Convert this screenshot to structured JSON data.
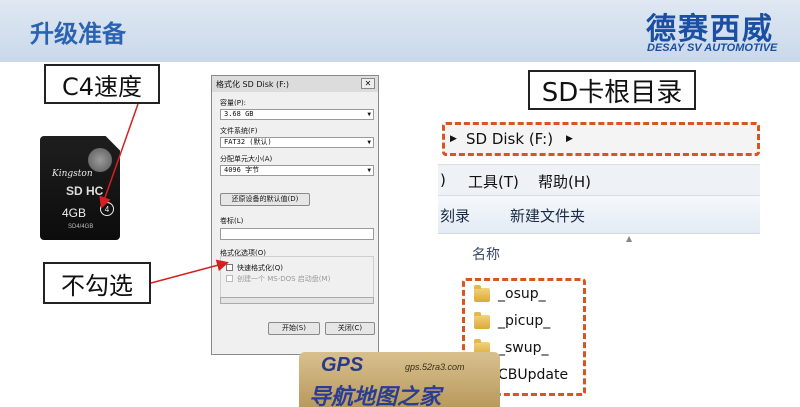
{
  "slide": {
    "title": "升级准备",
    "logo_cn": "德赛西威",
    "logo_en": "DESAY SV AUTOMOTIVE"
  },
  "callouts": {
    "speed": "C4速度",
    "uncheck": "不勾选",
    "sd_root": "SD卡根目录"
  },
  "sd_card": {
    "brand": "Kingston",
    "logo": "SD HC",
    "capacity": "4GB",
    "speed_class": "4",
    "model": "SD4/4GB"
  },
  "format_dialog": {
    "title": "格式化 SD Disk (F:)",
    "close_glyph": "✕",
    "capacity_label": "容量(P):",
    "capacity_value": "3.68 GB",
    "filesystem_label": "文件系统(F)",
    "filesystem_value": "FAT32 (默认)",
    "alloc_label": "分配单元大小(A)",
    "alloc_value": "4096 字节",
    "restore_button": "还原设备的默认值(D)",
    "volume_label": "卷标(L)",
    "options_label": "格式化选项(O)",
    "quick_format": "快速格式化(Q)",
    "msdos_disk": "创建一个 MS-DOS 启动盘(M)",
    "start_button": "开始(S)",
    "close_button": "关闭(C)"
  },
  "explorer": {
    "address": "SD Disk (F:)",
    "menu": [
      "工具(T)",
      "帮助(H)"
    ],
    "toolbar": [
      "刻录",
      "新建文件夹"
    ],
    "column_name": "名称",
    "files": [
      "_osup_",
      "_picup_",
      "_swup_",
      "CBUpdate"
    ]
  },
  "watermark": {
    "gps": "GPS",
    "url": "gps.52ra3.com",
    "text": "导航地图之家"
  },
  "colors": {
    "title_blue": "#2b63b3",
    "dashed_orange": "#d9541e",
    "arrow_red": "#d42020"
  }
}
